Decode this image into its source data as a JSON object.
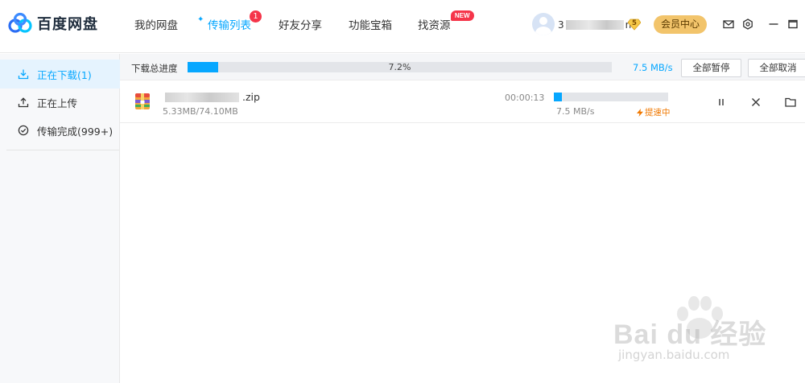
{
  "app": {
    "name": "百度网盘"
  },
  "nav": {
    "items": [
      {
        "label": "我的网盘"
      },
      {
        "label": "传输列表",
        "badge": "1",
        "active": true
      },
      {
        "label": "好友分享"
      },
      {
        "label": "功能宝箱"
      },
      {
        "label": "找资源",
        "badge": "NEW"
      }
    ]
  },
  "user": {
    "name_prefix": "3",
    "name_suffix": "n",
    "vip_level": "5",
    "member_center_label": "会员中心"
  },
  "sidebar": {
    "items": [
      {
        "label": "正在下载(1)",
        "icon": "download-icon",
        "active": true
      },
      {
        "label": "正在上传",
        "icon": "upload-icon"
      },
      {
        "label": "传输完成(999+)",
        "icon": "check-circle-icon"
      }
    ]
  },
  "summary": {
    "label": "下载总进度",
    "progress": 0.072,
    "progress_text": "7.2%",
    "speed": "7.5 MB/s",
    "pause_all_label": "全部暂停",
    "cancel_all_label": "全部取消"
  },
  "tasks": [
    {
      "name_ext": ".zip",
      "size": "5.33MB/74.10MB",
      "time_left": "00:00:13",
      "progress": 0.072,
      "speed": "7.5 MB/s",
      "boost_label": "提速中"
    }
  ],
  "watermark": {
    "text": "Bai du 经验",
    "url": "jingyan.baidu.com"
  },
  "colors": {
    "accent": "#06a7ff",
    "badge": "#f5354a",
    "member": "#f2c46b",
    "boost": "#f07800"
  }
}
